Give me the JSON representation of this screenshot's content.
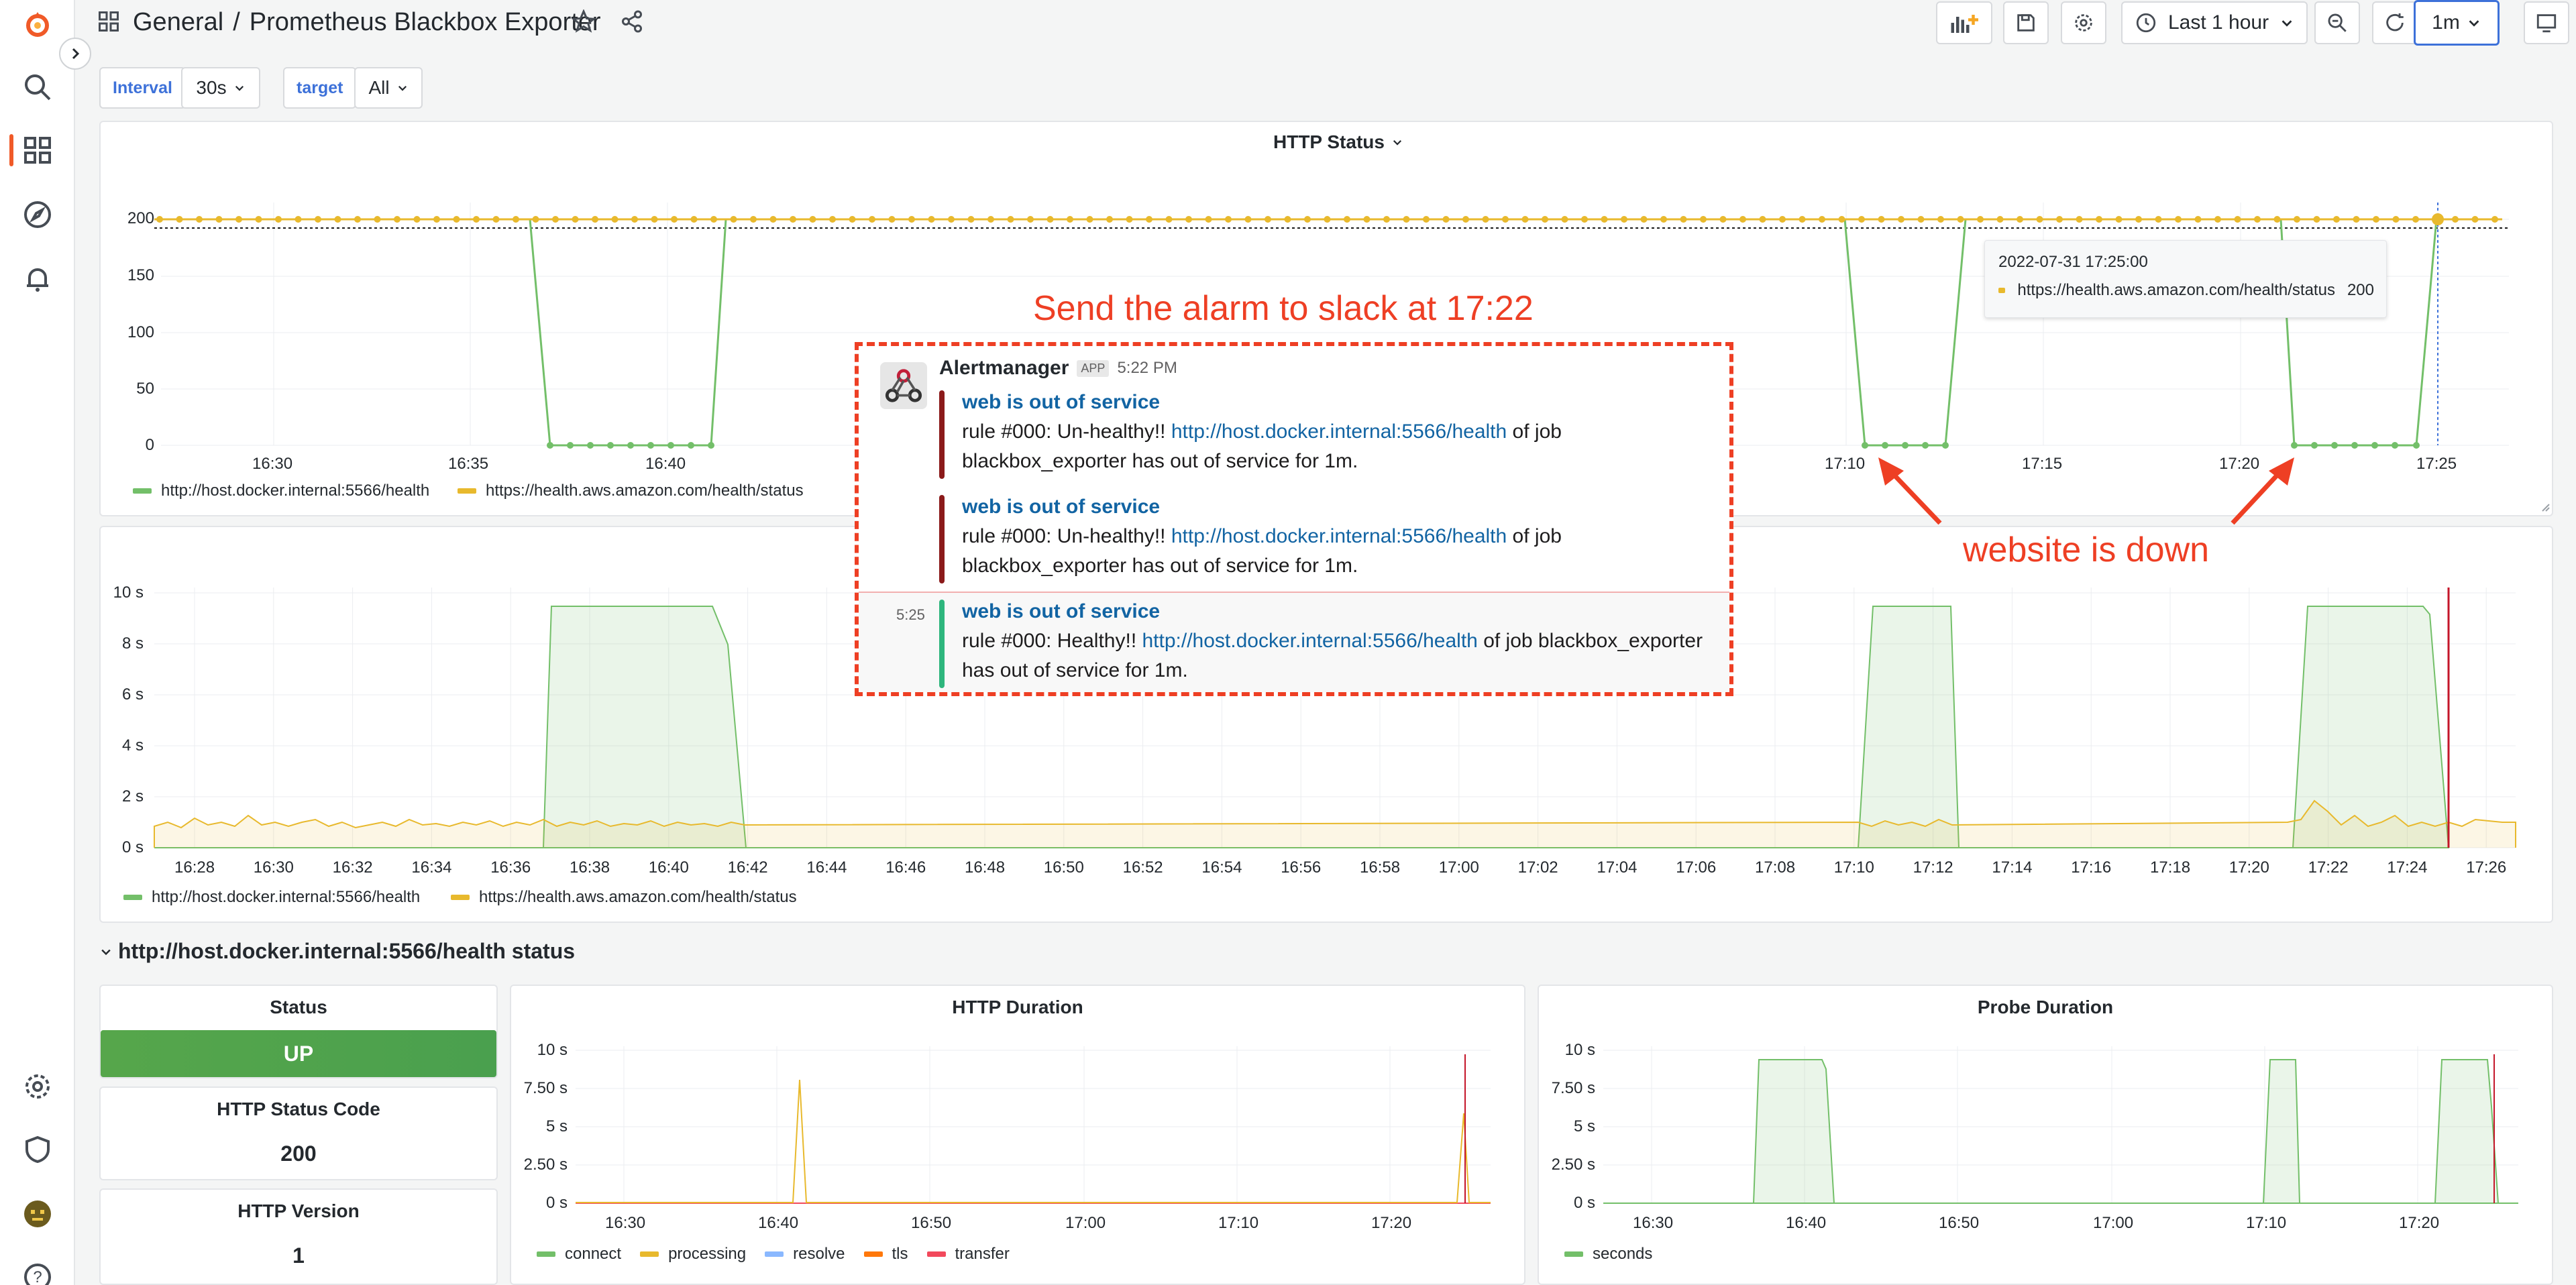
{
  "header": {
    "folder": "General",
    "separator": "/",
    "title": "Prometheus Blackbox Exporter",
    "time_range": "Last 1 hour",
    "refresh": "1m"
  },
  "variables": {
    "interval_label": "Interval",
    "interval_value": "30s",
    "target_label": "target",
    "target_value": "All"
  },
  "http_status_panel": {
    "title": "HTTP Status",
    "y_ticks": [
      "200",
      "150",
      "100",
      "50",
      "0"
    ],
    "x_ticks": [
      "16:30",
      "16:35",
      "16:40",
      "17:10",
      "17:15",
      "17:20",
      "17:25"
    ],
    "legend": [
      "http://host.docker.internal:5566/health",
      "https://health.aws.amazon.com/health/status"
    ],
    "tooltip_time": "2022-07-31 17:25:00",
    "tooltip_series": "https://health.aws.amazon.com/health/status",
    "tooltip_value": "200"
  },
  "probe_panel": {
    "y_ticks": [
      "10 s",
      "8 s",
      "6 s",
      "4 s",
      "2 s",
      "0 s"
    ],
    "x_ticks": [
      "16:28",
      "16:30",
      "16:32",
      "16:34",
      "16:36",
      "16:38",
      "16:40",
      "16:42",
      "16:44",
      "16:46",
      "16:48",
      "16:50",
      "16:52",
      "16:54",
      "16:56",
      "16:58",
      "17:00",
      "17:02",
      "17:04",
      "17:06",
      "17:08",
      "17:10",
      "17:12",
      "17:14",
      "17:16",
      "17:18",
      "17:20",
      "17:22",
      "17:24",
      "17:26"
    ],
    "legend": [
      "http://host.docker.internal:5566/health",
      "https://health.aws.amazon.com/health/status"
    ]
  },
  "row": {
    "title": "http://host.docker.internal:5566/health status"
  },
  "stats": {
    "status_title": "Status",
    "status_value": "UP",
    "code_title": "HTTP Status Code",
    "code_value": "200",
    "version_title": "HTTP Version",
    "version_value": "1"
  },
  "http_duration": {
    "title": "HTTP Duration",
    "y_ticks": [
      "10 s",
      "7.50 s",
      "5 s",
      "2.50 s",
      "0 s"
    ],
    "x_ticks": [
      "16:30",
      "16:40",
      "16:50",
      "17:00",
      "17:10",
      "17:20"
    ],
    "legend": [
      "connect",
      "processing",
      "resolve",
      "tls",
      "transfer"
    ]
  },
  "probe_duration": {
    "title": "Probe Duration",
    "y_ticks": [
      "10 s",
      "7.50 s",
      "5 s",
      "2.50 s",
      "0 s"
    ],
    "x_ticks": [
      "16:30",
      "16:40",
      "16:50",
      "17:00",
      "17:10",
      "17:20"
    ],
    "legend": [
      "seconds"
    ]
  },
  "annotations": {
    "slack_caption": "Send the alarm to slack at 17:22",
    "down_caption": "website is down"
  },
  "slack": {
    "sender": "Alertmanager",
    "badge": "APP",
    "time": "5:22 PM",
    "time2": "5:25",
    "messages": [
      {
        "title": "web is out of service",
        "prefix": "rule #000:  Un-healthy!!  ",
        "link": "http://host.docker.internal:5566/health",
        "suffix": " of job",
        "line2": "blackbox_exporter has out of service for 1m."
      },
      {
        "title": "web is out of service",
        "prefix": "rule #000:  Un-healthy!!  ",
        "link": "http://host.docker.internal:5566/health",
        "suffix": " of job",
        "line2": "blackbox_exporter has out of service for 1m."
      },
      {
        "title": "web is out of service",
        "prefix": "rule #000:  Healthy!!  ",
        "link": "http://host.docker.internal:5566/health",
        "suffix": " of job blackbox_exporter",
        "line2": "has out of service for 1m."
      }
    ]
  },
  "colors": {
    "green": "#73bf69",
    "yellow": "#e8b92d",
    "blue": "#8ab8ff",
    "orange": "#ff780a",
    "red": "#f2495c",
    "annotation_red": "#ee3f24",
    "stat_green": "#56a64b"
  },
  "icons": [
    "grafana-logo-icon",
    "search-icon",
    "dashboards-icon",
    "explore-icon",
    "alerting-icon",
    "settings-icon",
    "shield-icon",
    "avatar",
    "help-icon",
    "grid-icon",
    "star-icon",
    "share-icon",
    "add-panel-icon",
    "save-icon",
    "gear-icon",
    "clock-icon",
    "chevron-down-icon",
    "zoom-out-icon",
    "refresh-icon",
    "tv-icon"
  ]
}
